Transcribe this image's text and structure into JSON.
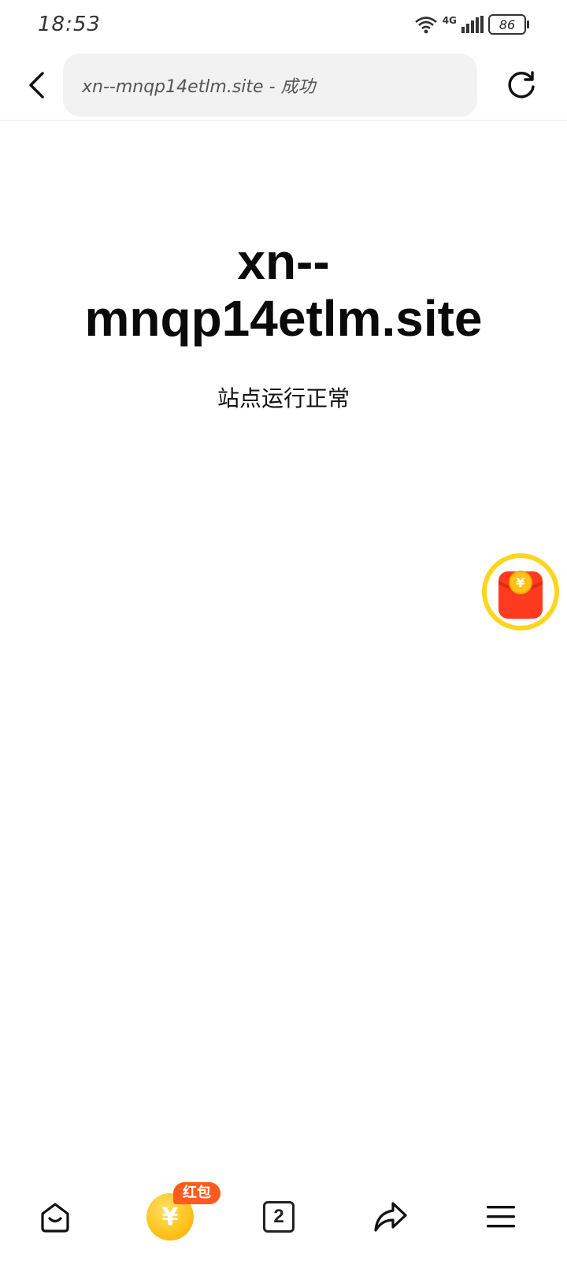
{
  "status_bar": {
    "time": "18:53",
    "network": "4G",
    "battery_level": "86"
  },
  "address_bar": {
    "url_text": "xn--mnqp14etlm.site - 成功"
  },
  "main": {
    "heading": "xn--mnqp14etlm.site",
    "status_text": "站点运行正常"
  },
  "bottom_nav": {
    "tabs_count": "2",
    "coin_symbol": "¥",
    "hongbao_badge": "红包"
  },
  "colors": {
    "accent_yellow": "#ffd51f",
    "red_packet": "#ff3b1f",
    "badge_orange": "#ff5a1f"
  }
}
